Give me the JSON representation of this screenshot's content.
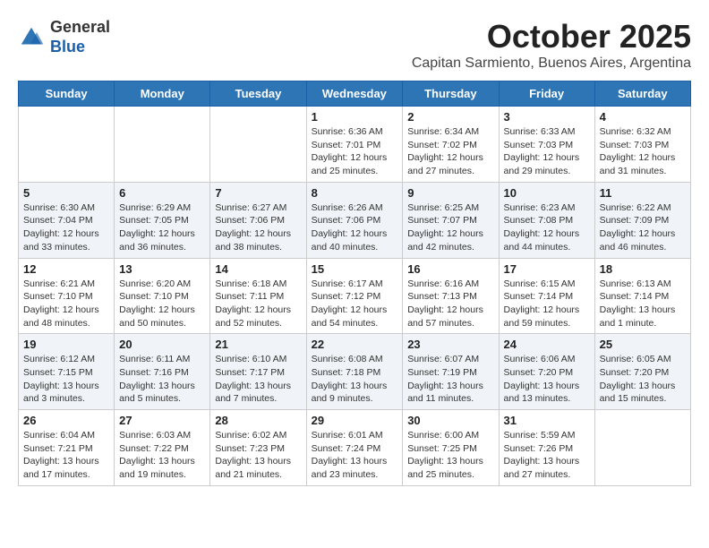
{
  "header": {
    "logo_line1": "General",
    "logo_line2": "Blue",
    "month": "October 2025",
    "location": "Capitan Sarmiento, Buenos Aires, Argentina"
  },
  "days_of_week": [
    "Sunday",
    "Monday",
    "Tuesday",
    "Wednesday",
    "Thursday",
    "Friday",
    "Saturday"
  ],
  "weeks": [
    [
      {
        "day": "",
        "info": ""
      },
      {
        "day": "",
        "info": ""
      },
      {
        "day": "",
        "info": ""
      },
      {
        "day": "1",
        "info": "Sunrise: 6:36 AM\nSunset: 7:01 PM\nDaylight: 12 hours\nand 25 minutes."
      },
      {
        "day": "2",
        "info": "Sunrise: 6:34 AM\nSunset: 7:02 PM\nDaylight: 12 hours\nand 27 minutes."
      },
      {
        "day": "3",
        "info": "Sunrise: 6:33 AM\nSunset: 7:03 PM\nDaylight: 12 hours\nand 29 minutes."
      },
      {
        "day": "4",
        "info": "Sunrise: 6:32 AM\nSunset: 7:03 PM\nDaylight: 12 hours\nand 31 minutes."
      }
    ],
    [
      {
        "day": "5",
        "info": "Sunrise: 6:30 AM\nSunset: 7:04 PM\nDaylight: 12 hours\nand 33 minutes."
      },
      {
        "day": "6",
        "info": "Sunrise: 6:29 AM\nSunset: 7:05 PM\nDaylight: 12 hours\nand 36 minutes."
      },
      {
        "day": "7",
        "info": "Sunrise: 6:27 AM\nSunset: 7:06 PM\nDaylight: 12 hours\nand 38 minutes."
      },
      {
        "day": "8",
        "info": "Sunrise: 6:26 AM\nSunset: 7:06 PM\nDaylight: 12 hours\nand 40 minutes."
      },
      {
        "day": "9",
        "info": "Sunrise: 6:25 AM\nSunset: 7:07 PM\nDaylight: 12 hours\nand 42 minutes."
      },
      {
        "day": "10",
        "info": "Sunrise: 6:23 AM\nSunset: 7:08 PM\nDaylight: 12 hours\nand 44 minutes."
      },
      {
        "day": "11",
        "info": "Sunrise: 6:22 AM\nSunset: 7:09 PM\nDaylight: 12 hours\nand 46 minutes."
      }
    ],
    [
      {
        "day": "12",
        "info": "Sunrise: 6:21 AM\nSunset: 7:10 PM\nDaylight: 12 hours\nand 48 minutes."
      },
      {
        "day": "13",
        "info": "Sunrise: 6:20 AM\nSunset: 7:10 PM\nDaylight: 12 hours\nand 50 minutes."
      },
      {
        "day": "14",
        "info": "Sunrise: 6:18 AM\nSunset: 7:11 PM\nDaylight: 12 hours\nand 52 minutes."
      },
      {
        "day": "15",
        "info": "Sunrise: 6:17 AM\nSunset: 7:12 PM\nDaylight: 12 hours\nand 54 minutes."
      },
      {
        "day": "16",
        "info": "Sunrise: 6:16 AM\nSunset: 7:13 PM\nDaylight: 12 hours\nand 57 minutes."
      },
      {
        "day": "17",
        "info": "Sunrise: 6:15 AM\nSunset: 7:14 PM\nDaylight: 12 hours\nand 59 minutes."
      },
      {
        "day": "18",
        "info": "Sunrise: 6:13 AM\nSunset: 7:14 PM\nDaylight: 13 hours\nand 1 minute."
      }
    ],
    [
      {
        "day": "19",
        "info": "Sunrise: 6:12 AM\nSunset: 7:15 PM\nDaylight: 13 hours\nand 3 minutes."
      },
      {
        "day": "20",
        "info": "Sunrise: 6:11 AM\nSunset: 7:16 PM\nDaylight: 13 hours\nand 5 minutes."
      },
      {
        "day": "21",
        "info": "Sunrise: 6:10 AM\nSunset: 7:17 PM\nDaylight: 13 hours\nand 7 minutes."
      },
      {
        "day": "22",
        "info": "Sunrise: 6:08 AM\nSunset: 7:18 PM\nDaylight: 13 hours\nand 9 minutes."
      },
      {
        "day": "23",
        "info": "Sunrise: 6:07 AM\nSunset: 7:19 PM\nDaylight: 13 hours\nand 11 minutes."
      },
      {
        "day": "24",
        "info": "Sunrise: 6:06 AM\nSunset: 7:20 PM\nDaylight: 13 hours\nand 13 minutes."
      },
      {
        "day": "25",
        "info": "Sunrise: 6:05 AM\nSunset: 7:20 PM\nDaylight: 13 hours\nand 15 minutes."
      }
    ],
    [
      {
        "day": "26",
        "info": "Sunrise: 6:04 AM\nSunset: 7:21 PM\nDaylight: 13 hours\nand 17 minutes."
      },
      {
        "day": "27",
        "info": "Sunrise: 6:03 AM\nSunset: 7:22 PM\nDaylight: 13 hours\nand 19 minutes."
      },
      {
        "day": "28",
        "info": "Sunrise: 6:02 AM\nSunset: 7:23 PM\nDaylight: 13 hours\nand 21 minutes."
      },
      {
        "day": "29",
        "info": "Sunrise: 6:01 AM\nSunset: 7:24 PM\nDaylight: 13 hours\nand 23 minutes."
      },
      {
        "day": "30",
        "info": "Sunrise: 6:00 AM\nSunset: 7:25 PM\nDaylight: 13 hours\nand 25 minutes."
      },
      {
        "day": "31",
        "info": "Sunrise: 5:59 AM\nSunset: 7:26 PM\nDaylight: 13 hours\nand 27 minutes."
      },
      {
        "day": "",
        "info": ""
      }
    ]
  ]
}
